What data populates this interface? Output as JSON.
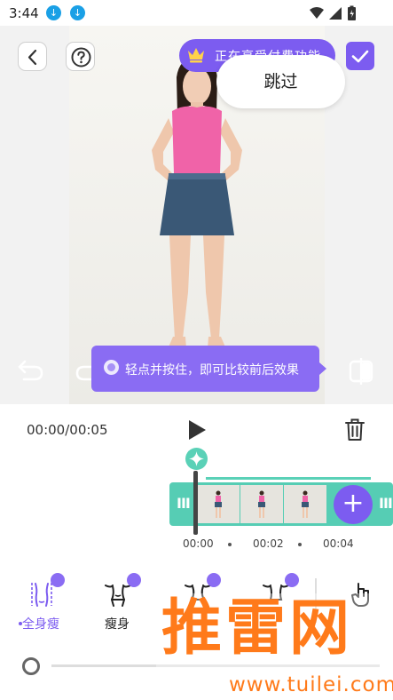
{
  "status_bar": {
    "time": "3:44"
  },
  "preview": {
    "vip_banner": "正在享受付费功能",
    "skip_label": "跳过",
    "tooltip": "轻点并按住，即可比较前后效果"
  },
  "timeline": {
    "time_readout": "00:00/00:05",
    "ticks": [
      "00:00",
      "00:02",
      "00:04"
    ]
  },
  "tools": [
    {
      "label": "全身瘦",
      "active": true
    },
    {
      "label": "瘦身",
      "active": false
    }
  ],
  "watermark": {
    "text": "推雷网",
    "url": "www.tuilei.com"
  },
  "colors": {
    "accent": "#7c5cf0",
    "timeline": "#56cdb4",
    "watermark": "#ff7a1a"
  }
}
